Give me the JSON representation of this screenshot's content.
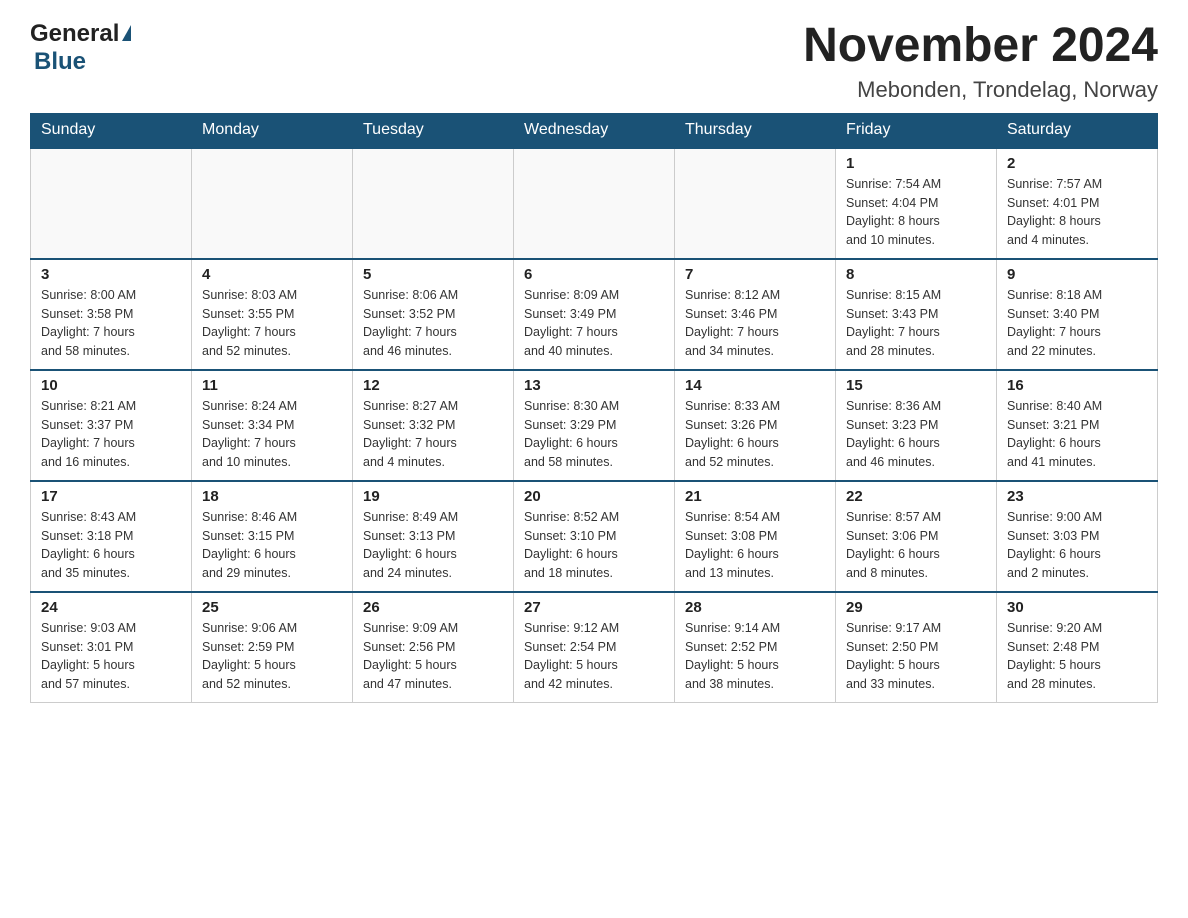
{
  "logo": {
    "text_general": "General",
    "text_blue": "Blue",
    "arrow_symbol": "▲"
  },
  "title": "November 2024",
  "subtitle": "Mebonden, Trondelag, Norway",
  "headers": [
    "Sunday",
    "Monday",
    "Tuesday",
    "Wednesday",
    "Thursday",
    "Friday",
    "Saturday"
  ],
  "weeks": [
    [
      {
        "day": "",
        "info": ""
      },
      {
        "day": "",
        "info": ""
      },
      {
        "day": "",
        "info": ""
      },
      {
        "day": "",
        "info": ""
      },
      {
        "day": "",
        "info": ""
      },
      {
        "day": "1",
        "info": "Sunrise: 7:54 AM\nSunset: 4:04 PM\nDaylight: 8 hours\nand 10 minutes."
      },
      {
        "day": "2",
        "info": "Sunrise: 7:57 AM\nSunset: 4:01 PM\nDaylight: 8 hours\nand 4 minutes."
      }
    ],
    [
      {
        "day": "3",
        "info": "Sunrise: 8:00 AM\nSunset: 3:58 PM\nDaylight: 7 hours\nand 58 minutes."
      },
      {
        "day": "4",
        "info": "Sunrise: 8:03 AM\nSunset: 3:55 PM\nDaylight: 7 hours\nand 52 minutes."
      },
      {
        "day": "5",
        "info": "Sunrise: 8:06 AM\nSunset: 3:52 PM\nDaylight: 7 hours\nand 46 minutes."
      },
      {
        "day": "6",
        "info": "Sunrise: 8:09 AM\nSunset: 3:49 PM\nDaylight: 7 hours\nand 40 minutes."
      },
      {
        "day": "7",
        "info": "Sunrise: 8:12 AM\nSunset: 3:46 PM\nDaylight: 7 hours\nand 34 minutes."
      },
      {
        "day": "8",
        "info": "Sunrise: 8:15 AM\nSunset: 3:43 PM\nDaylight: 7 hours\nand 28 minutes."
      },
      {
        "day": "9",
        "info": "Sunrise: 8:18 AM\nSunset: 3:40 PM\nDaylight: 7 hours\nand 22 minutes."
      }
    ],
    [
      {
        "day": "10",
        "info": "Sunrise: 8:21 AM\nSunset: 3:37 PM\nDaylight: 7 hours\nand 16 minutes."
      },
      {
        "day": "11",
        "info": "Sunrise: 8:24 AM\nSunset: 3:34 PM\nDaylight: 7 hours\nand 10 minutes."
      },
      {
        "day": "12",
        "info": "Sunrise: 8:27 AM\nSunset: 3:32 PM\nDaylight: 7 hours\nand 4 minutes."
      },
      {
        "day": "13",
        "info": "Sunrise: 8:30 AM\nSunset: 3:29 PM\nDaylight: 6 hours\nand 58 minutes."
      },
      {
        "day": "14",
        "info": "Sunrise: 8:33 AM\nSunset: 3:26 PM\nDaylight: 6 hours\nand 52 minutes."
      },
      {
        "day": "15",
        "info": "Sunrise: 8:36 AM\nSunset: 3:23 PM\nDaylight: 6 hours\nand 46 minutes."
      },
      {
        "day": "16",
        "info": "Sunrise: 8:40 AM\nSunset: 3:21 PM\nDaylight: 6 hours\nand 41 minutes."
      }
    ],
    [
      {
        "day": "17",
        "info": "Sunrise: 8:43 AM\nSunset: 3:18 PM\nDaylight: 6 hours\nand 35 minutes."
      },
      {
        "day": "18",
        "info": "Sunrise: 8:46 AM\nSunset: 3:15 PM\nDaylight: 6 hours\nand 29 minutes."
      },
      {
        "day": "19",
        "info": "Sunrise: 8:49 AM\nSunset: 3:13 PM\nDaylight: 6 hours\nand 24 minutes."
      },
      {
        "day": "20",
        "info": "Sunrise: 8:52 AM\nSunset: 3:10 PM\nDaylight: 6 hours\nand 18 minutes."
      },
      {
        "day": "21",
        "info": "Sunrise: 8:54 AM\nSunset: 3:08 PM\nDaylight: 6 hours\nand 13 minutes."
      },
      {
        "day": "22",
        "info": "Sunrise: 8:57 AM\nSunset: 3:06 PM\nDaylight: 6 hours\nand 8 minutes."
      },
      {
        "day": "23",
        "info": "Sunrise: 9:00 AM\nSunset: 3:03 PM\nDaylight: 6 hours\nand 2 minutes."
      }
    ],
    [
      {
        "day": "24",
        "info": "Sunrise: 9:03 AM\nSunset: 3:01 PM\nDaylight: 5 hours\nand 57 minutes."
      },
      {
        "day": "25",
        "info": "Sunrise: 9:06 AM\nSunset: 2:59 PM\nDaylight: 5 hours\nand 52 minutes."
      },
      {
        "day": "26",
        "info": "Sunrise: 9:09 AM\nSunset: 2:56 PM\nDaylight: 5 hours\nand 47 minutes."
      },
      {
        "day": "27",
        "info": "Sunrise: 9:12 AM\nSunset: 2:54 PM\nDaylight: 5 hours\nand 42 minutes."
      },
      {
        "day": "28",
        "info": "Sunrise: 9:14 AM\nSunset: 2:52 PM\nDaylight: 5 hours\nand 38 minutes."
      },
      {
        "day": "29",
        "info": "Sunrise: 9:17 AM\nSunset: 2:50 PM\nDaylight: 5 hours\nand 33 minutes."
      },
      {
        "day": "30",
        "info": "Sunrise: 9:20 AM\nSunset: 2:48 PM\nDaylight: 5 hours\nand 28 minutes."
      }
    ]
  ]
}
